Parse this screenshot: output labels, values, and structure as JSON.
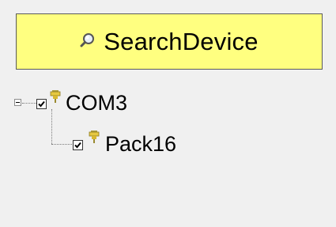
{
  "toolbar": {
    "search_label": "SearchDevice",
    "search_icon": "magnifier-icon",
    "button_color": "#ffff80"
  },
  "tree": {
    "nodes": [
      {
        "label": "COM3",
        "checked": true,
        "expanded": true,
        "icon": "serial-port-icon"
      },
      {
        "label": "Pack16",
        "checked": true,
        "icon": "serial-port-icon"
      }
    ]
  }
}
